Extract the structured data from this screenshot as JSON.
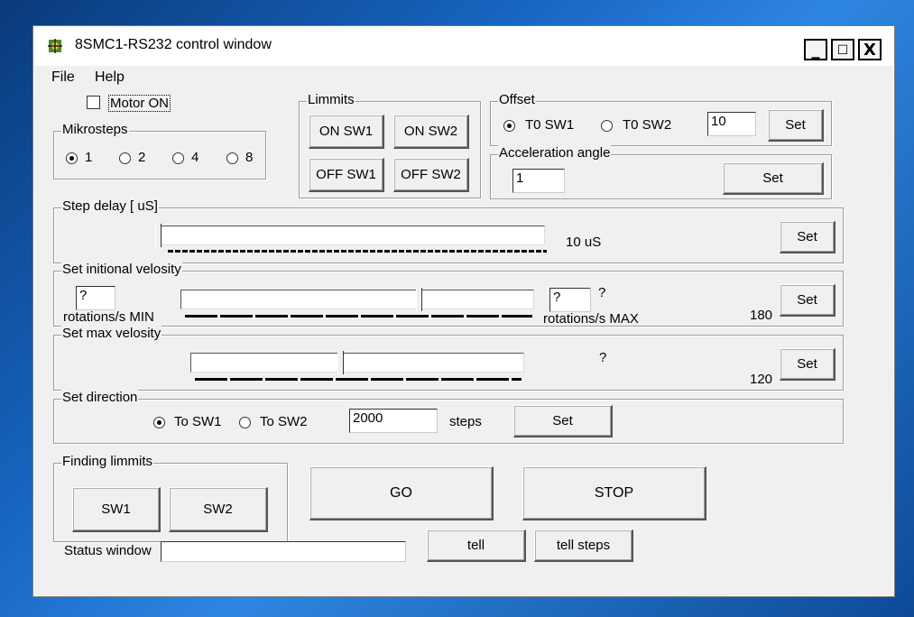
{
  "window": {
    "title": "8SMC1-RS232  control window"
  },
  "caption": {
    "minimize": "_",
    "maximize": "☐",
    "close": "X"
  },
  "menu": {
    "file": "File",
    "help": "Help"
  },
  "motor": {
    "label": "Motor ON",
    "checked": false
  },
  "mikrosteps": {
    "legend": "Mikrosteps",
    "options": [
      "1",
      "2",
      "4",
      "8"
    ],
    "selected": "1"
  },
  "limmits": {
    "legend": "Limmits",
    "on_sw1": "ON SW1",
    "on_sw2": "ON SW2",
    "off_sw1": "OFF SW1",
    "off_sw2": "OFF SW2"
  },
  "offset": {
    "legend": "Offset",
    "opt1": "T0 SW1",
    "opt2": "T0 SW2",
    "selected": "T0 SW1",
    "value": "10",
    "set": "Set"
  },
  "accel": {
    "legend": "Acceleration angle",
    "value": "1",
    "set": "Set"
  },
  "step_delay": {
    "legend": "Step delay [ uS]",
    "value_text": "10 uS",
    "set": "Set",
    "slider_fraction": 0.0
  },
  "init_velocity": {
    "legend": "Set initional velosity",
    "min_value": "?",
    "min_label": "rotations/s MIN",
    "max_value": "?",
    "max_label": "rotations/s MAX",
    "question": "?",
    "value": "180",
    "set": "Set",
    "slider_fraction": 0.68
  },
  "max_velocity": {
    "legend": "Set max velosity",
    "question": "?",
    "value": "120",
    "set": "Set",
    "slider_fraction": 0.45
  },
  "direction": {
    "legend": "Set direction",
    "opt1": "To SW1",
    "opt2": "To SW2",
    "selected": "To SW1",
    "steps_value": "2000",
    "steps_label": "steps",
    "set": "Set"
  },
  "finding": {
    "legend": "Finding limmits",
    "sw1": "SW1",
    "sw2": "SW2"
  },
  "actions": {
    "go": "GO",
    "stop": "STOP",
    "tell": "tell",
    "tell_steps": "tell steps"
  },
  "status": {
    "label": "Status window",
    "value": ""
  }
}
